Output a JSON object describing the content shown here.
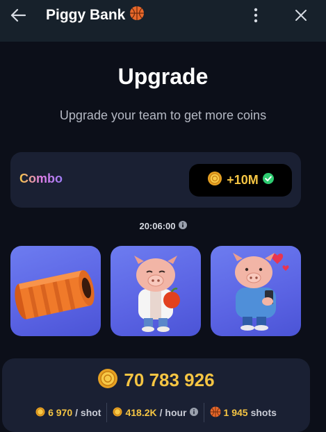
{
  "header": {
    "title": "Piggy Bank",
    "title_icon": "basketball-icon",
    "back_icon": "arrow-left-icon",
    "menu_icon": "more-vertical-icon",
    "close_icon": "close-icon"
  },
  "main": {
    "title": "Upgrade",
    "subtitle": "Upgrade your team to get more coins"
  },
  "combo": {
    "label": "Combo",
    "reward": "+10M",
    "reward_icon": "coin-icon",
    "status_icon": "check-circle-icon"
  },
  "timer": {
    "value": "20:06:00",
    "icon": "info-icon"
  },
  "cards": [
    {
      "name": "orange-foam-roller",
      "icon": "foam-roller-icon"
    },
    {
      "name": "pig-chef-with-apple",
      "icon": "pig-character-icon"
    },
    {
      "name": "pig-with-phone",
      "icon": "pig-character-icon"
    }
  ],
  "stats": {
    "balance": "70 783 926",
    "per_shot_value": "6 970",
    "per_shot_unit": "/ shot",
    "per_hour_value": "418.2K",
    "per_hour_unit": "/ hour",
    "shots_value": "1 945",
    "shots_unit": "shots"
  },
  "colors": {
    "header_bg": "#17212b",
    "page_bg": "#0c0f19",
    "card_bg": "#1a2033",
    "accent_gold": "#f5c543",
    "check_green": "#2ecc71",
    "item_card": "#5a63e3"
  }
}
